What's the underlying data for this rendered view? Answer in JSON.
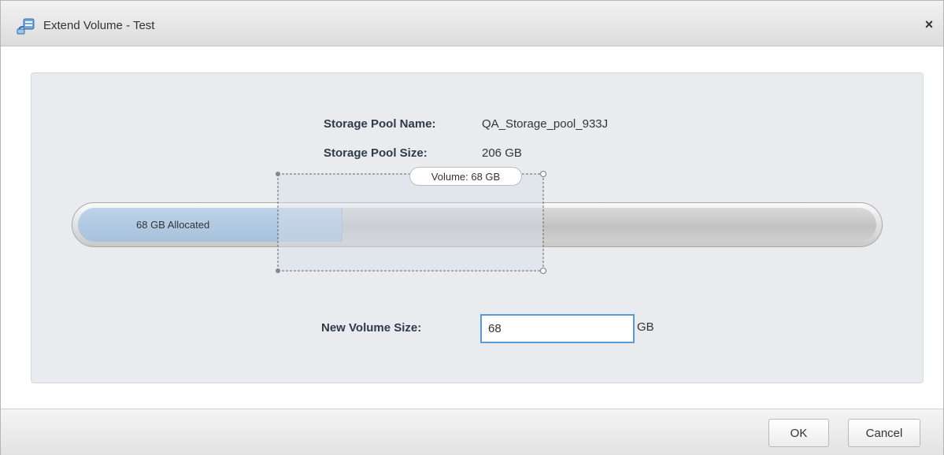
{
  "dialog": {
    "title": "Extend Volume - Test",
    "close_symbol": "×",
    "title_icon": "volume-icon"
  },
  "pool": {
    "name_label": "Storage Pool Name:",
    "name_value": "QA_Storage_pool_933J",
    "size_label": "Storage Pool Size:",
    "size_value": "206 GB"
  },
  "usage": {
    "allocated_label": "68 GB Allocated",
    "volume_label": "Volume: 68 GB",
    "allocated_gb": 68,
    "total_gb": 206
  },
  "new_size": {
    "label": "New Volume Size:",
    "value": "68",
    "unit": "GB"
  },
  "buttons": {
    "ok": "OK",
    "cancel": "Cancel"
  }
}
